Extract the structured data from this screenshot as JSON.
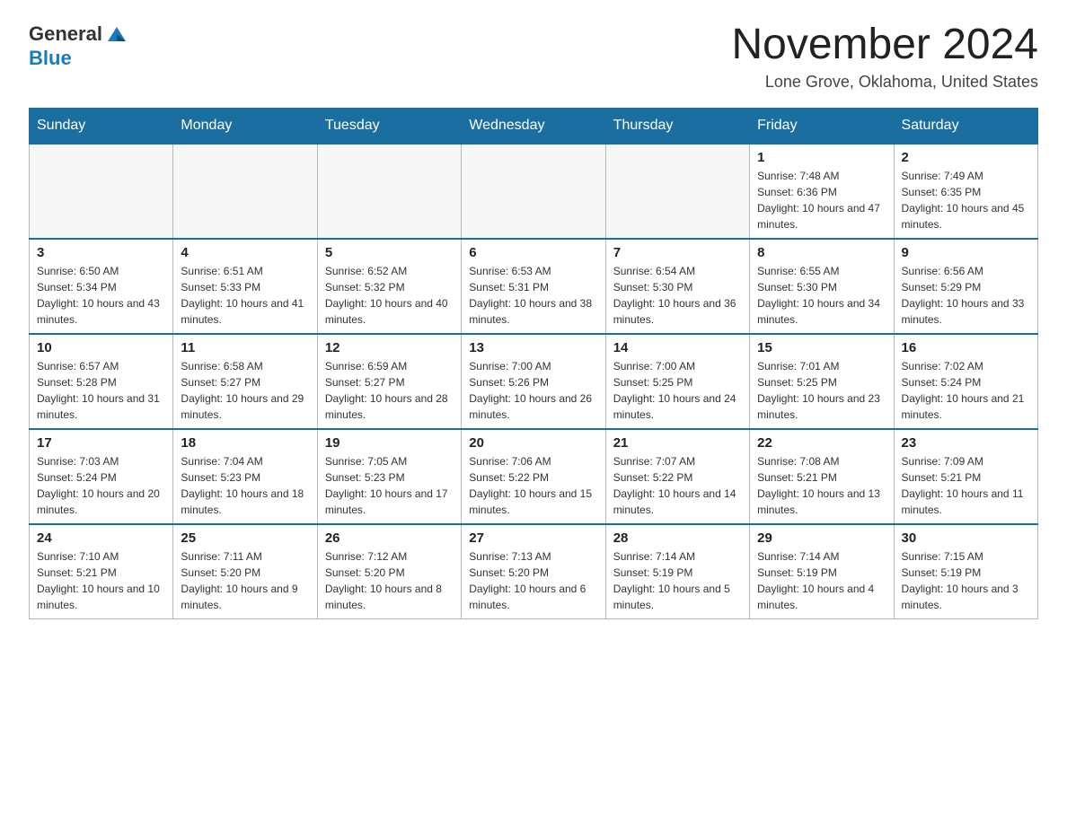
{
  "header": {
    "logo_general": "General",
    "logo_blue": "Blue",
    "month_title": "November 2024",
    "location": "Lone Grove, Oklahoma, United States"
  },
  "days_of_week": [
    "Sunday",
    "Monday",
    "Tuesday",
    "Wednesday",
    "Thursday",
    "Friday",
    "Saturday"
  ],
  "weeks": [
    [
      {
        "day": "",
        "sunrise": "",
        "sunset": "",
        "daylight": ""
      },
      {
        "day": "",
        "sunrise": "",
        "sunset": "",
        "daylight": ""
      },
      {
        "day": "",
        "sunrise": "",
        "sunset": "",
        "daylight": ""
      },
      {
        "day": "",
        "sunrise": "",
        "sunset": "",
        "daylight": ""
      },
      {
        "day": "",
        "sunrise": "",
        "sunset": "",
        "daylight": ""
      },
      {
        "day": "1",
        "sunrise": "Sunrise: 7:48 AM",
        "sunset": "Sunset: 6:36 PM",
        "daylight": "Daylight: 10 hours and 47 minutes."
      },
      {
        "day": "2",
        "sunrise": "Sunrise: 7:49 AM",
        "sunset": "Sunset: 6:35 PM",
        "daylight": "Daylight: 10 hours and 45 minutes."
      }
    ],
    [
      {
        "day": "3",
        "sunrise": "Sunrise: 6:50 AM",
        "sunset": "Sunset: 5:34 PM",
        "daylight": "Daylight: 10 hours and 43 minutes."
      },
      {
        "day": "4",
        "sunrise": "Sunrise: 6:51 AM",
        "sunset": "Sunset: 5:33 PM",
        "daylight": "Daylight: 10 hours and 41 minutes."
      },
      {
        "day": "5",
        "sunrise": "Sunrise: 6:52 AM",
        "sunset": "Sunset: 5:32 PM",
        "daylight": "Daylight: 10 hours and 40 minutes."
      },
      {
        "day": "6",
        "sunrise": "Sunrise: 6:53 AM",
        "sunset": "Sunset: 5:31 PM",
        "daylight": "Daylight: 10 hours and 38 minutes."
      },
      {
        "day": "7",
        "sunrise": "Sunrise: 6:54 AM",
        "sunset": "Sunset: 5:30 PM",
        "daylight": "Daylight: 10 hours and 36 minutes."
      },
      {
        "day": "8",
        "sunrise": "Sunrise: 6:55 AM",
        "sunset": "Sunset: 5:30 PM",
        "daylight": "Daylight: 10 hours and 34 minutes."
      },
      {
        "day": "9",
        "sunrise": "Sunrise: 6:56 AM",
        "sunset": "Sunset: 5:29 PM",
        "daylight": "Daylight: 10 hours and 33 minutes."
      }
    ],
    [
      {
        "day": "10",
        "sunrise": "Sunrise: 6:57 AM",
        "sunset": "Sunset: 5:28 PM",
        "daylight": "Daylight: 10 hours and 31 minutes."
      },
      {
        "day": "11",
        "sunrise": "Sunrise: 6:58 AM",
        "sunset": "Sunset: 5:27 PM",
        "daylight": "Daylight: 10 hours and 29 minutes."
      },
      {
        "day": "12",
        "sunrise": "Sunrise: 6:59 AM",
        "sunset": "Sunset: 5:27 PM",
        "daylight": "Daylight: 10 hours and 28 minutes."
      },
      {
        "day": "13",
        "sunrise": "Sunrise: 7:00 AM",
        "sunset": "Sunset: 5:26 PM",
        "daylight": "Daylight: 10 hours and 26 minutes."
      },
      {
        "day": "14",
        "sunrise": "Sunrise: 7:00 AM",
        "sunset": "Sunset: 5:25 PM",
        "daylight": "Daylight: 10 hours and 24 minutes."
      },
      {
        "day": "15",
        "sunrise": "Sunrise: 7:01 AM",
        "sunset": "Sunset: 5:25 PM",
        "daylight": "Daylight: 10 hours and 23 minutes."
      },
      {
        "day": "16",
        "sunrise": "Sunrise: 7:02 AM",
        "sunset": "Sunset: 5:24 PM",
        "daylight": "Daylight: 10 hours and 21 minutes."
      }
    ],
    [
      {
        "day": "17",
        "sunrise": "Sunrise: 7:03 AM",
        "sunset": "Sunset: 5:24 PM",
        "daylight": "Daylight: 10 hours and 20 minutes."
      },
      {
        "day": "18",
        "sunrise": "Sunrise: 7:04 AM",
        "sunset": "Sunset: 5:23 PM",
        "daylight": "Daylight: 10 hours and 18 minutes."
      },
      {
        "day": "19",
        "sunrise": "Sunrise: 7:05 AM",
        "sunset": "Sunset: 5:23 PM",
        "daylight": "Daylight: 10 hours and 17 minutes."
      },
      {
        "day": "20",
        "sunrise": "Sunrise: 7:06 AM",
        "sunset": "Sunset: 5:22 PM",
        "daylight": "Daylight: 10 hours and 15 minutes."
      },
      {
        "day": "21",
        "sunrise": "Sunrise: 7:07 AM",
        "sunset": "Sunset: 5:22 PM",
        "daylight": "Daylight: 10 hours and 14 minutes."
      },
      {
        "day": "22",
        "sunrise": "Sunrise: 7:08 AM",
        "sunset": "Sunset: 5:21 PM",
        "daylight": "Daylight: 10 hours and 13 minutes."
      },
      {
        "day": "23",
        "sunrise": "Sunrise: 7:09 AM",
        "sunset": "Sunset: 5:21 PM",
        "daylight": "Daylight: 10 hours and 11 minutes."
      }
    ],
    [
      {
        "day": "24",
        "sunrise": "Sunrise: 7:10 AM",
        "sunset": "Sunset: 5:21 PM",
        "daylight": "Daylight: 10 hours and 10 minutes."
      },
      {
        "day": "25",
        "sunrise": "Sunrise: 7:11 AM",
        "sunset": "Sunset: 5:20 PM",
        "daylight": "Daylight: 10 hours and 9 minutes."
      },
      {
        "day": "26",
        "sunrise": "Sunrise: 7:12 AM",
        "sunset": "Sunset: 5:20 PM",
        "daylight": "Daylight: 10 hours and 8 minutes."
      },
      {
        "day": "27",
        "sunrise": "Sunrise: 7:13 AM",
        "sunset": "Sunset: 5:20 PM",
        "daylight": "Daylight: 10 hours and 6 minutes."
      },
      {
        "day": "28",
        "sunrise": "Sunrise: 7:14 AM",
        "sunset": "Sunset: 5:19 PM",
        "daylight": "Daylight: 10 hours and 5 minutes."
      },
      {
        "day": "29",
        "sunrise": "Sunrise: 7:14 AM",
        "sunset": "Sunset: 5:19 PM",
        "daylight": "Daylight: 10 hours and 4 minutes."
      },
      {
        "day": "30",
        "sunrise": "Sunrise: 7:15 AM",
        "sunset": "Sunset: 5:19 PM",
        "daylight": "Daylight: 10 hours and 3 minutes."
      }
    ]
  ]
}
